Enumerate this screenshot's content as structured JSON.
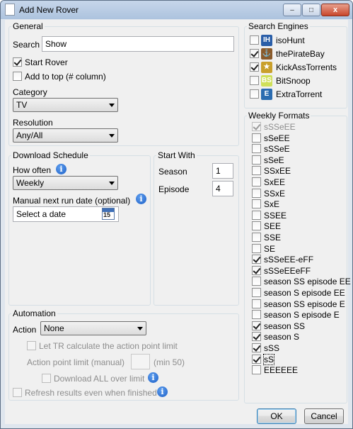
{
  "window": {
    "title": "Add New Rover",
    "minimize_glyph": "–",
    "maximize_glyph": "□",
    "close_glyph": "x"
  },
  "general": {
    "legend": "General",
    "search_label": "Search",
    "search_value": "Show",
    "start_rover": {
      "label": "Start Rover",
      "checked": true
    },
    "add_to_top": {
      "label": "Add to top (# column)",
      "checked": false
    },
    "category_label": "Category",
    "category_value": "TV",
    "resolution_label": "Resolution",
    "resolution_value": "Any/All"
  },
  "schedule": {
    "legend": "Download Schedule",
    "how_often_label": "How often",
    "how_often_value": "Weekly",
    "manual_date_label": "Manual next run date (optional)",
    "date_placeholder": "Select a date",
    "calendar_day": "15"
  },
  "start_with": {
    "legend": "Start With",
    "season_label": "Season",
    "season_value": "1",
    "episode_label": "Episode",
    "episode_value": "4"
  },
  "automation": {
    "legend": "Automation",
    "action_label": "Action",
    "action_value": "None",
    "let_tr_calc": "Let TR calculate the action point limit",
    "action_point_label": "Action point limit (manual)",
    "action_point_value": "",
    "min_label": "(min 50)",
    "download_all": "Download ALL over limit",
    "refresh_results": "Refresh results even when finished"
  },
  "search_engines": {
    "legend": "Search Engines",
    "items": [
      {
        "name": "isoHunt",
        "checked": false,
        "icon": "isohunt-icon",
        "color": "#2a5ea8"
      },
      {
        "name": "thePirateBay",
        "checked": true,
        "icon": "pirate-ship-icon",
        "color": "#8a5a2b"
      },
      {
        "name": "KickAssTorrents",
        "checked": true,
        "icon": "kickass-shield-icon",
        "color": "#c9a02c"
      },
      {
        "name": "BitSnoop",
        "checked": false,
        "icon": "bitsnoop-icon",
        "color": "#cfe05a"
      },
      {
        "name": "ExtraTorrent",
        "checked": false,
        "icon": "extratorrent-icon",
        "color": "#2b6cb0"
      }
    ]
  },
  "weekly_formats": {
    "legend": "Weekly Formats",
    "items": [
      {
        "label": "sSSeEE",
        "checked": true,
        "disabled": true
      },
      {
        "label": "sSeEE",
        "checked": false
      },
      {
        "label": "sSSeE",
        "checked": false
      },
      {
        "label": "sSeE",
        "checked": false
      },
      {
        "label": "SSxEE",
        "checked": false
      },
      {
        "label": "SxEE",
        "checked": false
      },
      {
        "label": "SSxE",
        "checked": false
      },
      {
        "label": "SxE",
        "checked": false
      },
      {
        "label": "SSEE",
        "checked": false
      },
      {
        "label": "SEE",
        "checked": false
      },
      {
        "label": "SSE",
        "checked": false
      },
      {
        "label": "SE",
        "checked": false
      },
      {
        "label": "sSSeEE-eFF",
        "checked": true
      },
      {
        "label": "sSSeEEeFF",
        "checked": true
      },
      {
        "label": "season SS episode EE",
        "checked": false
      },
      {
        "label": "season S episode EE",
        "checked": false
      },
      {
        "label": "season SS episode E",
        "checked": false
      },
      {
        "label": "season S episode E",
        "checked": false
      },
      {
        "label": "season SS",
        "checked": true
      },
      {
        "label": "season S",
        "checked": true
      },
      {
        "label": "sSS",
        "checked": true
      },
      {
        "label": "sS",
        "checked": true,
        "focused": true
      },
      {
        "label": "EEEEEE",
        "checked": false
      }
    ]
  },
  "buttons": {
    "ok": "OK",
    "cancel": "Cancel"
  }
}
